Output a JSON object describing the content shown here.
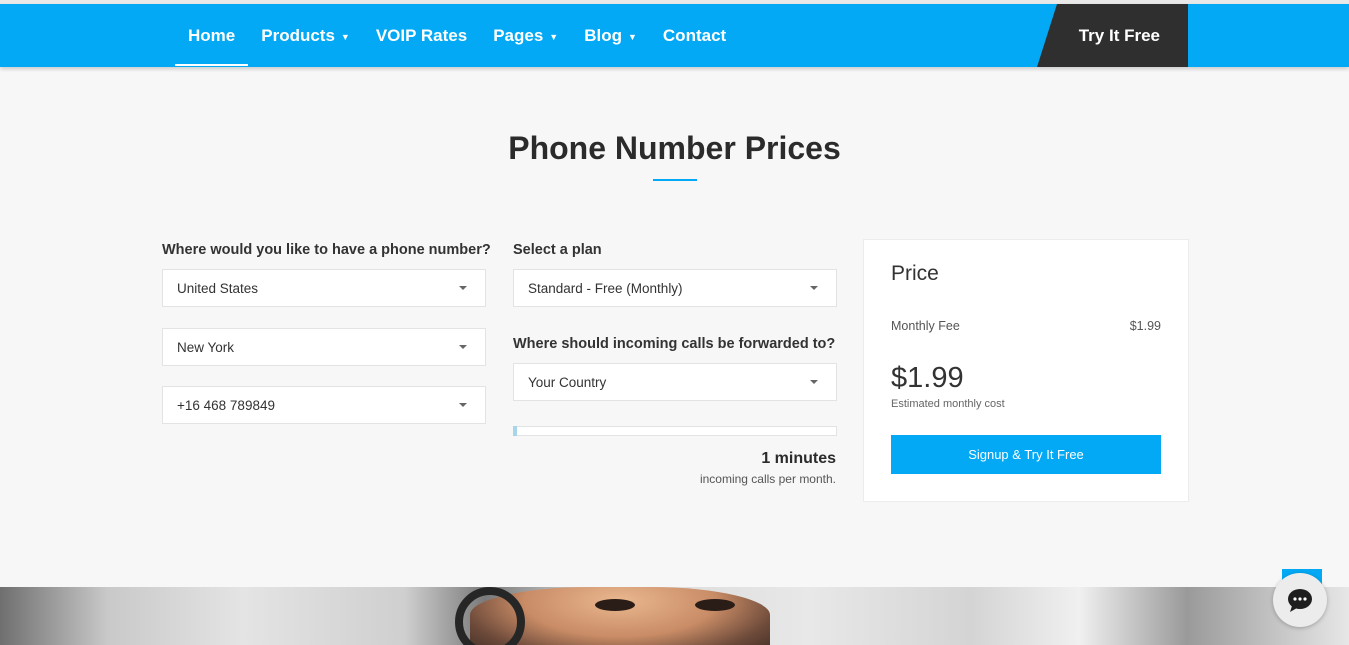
{
  "nav": {
    "items": [
      {
        "label": "Home",
        "dropdown": false,
        "active": true
      },
      {
        "label": "Products",
        "dropdown": true,
        "active": false
      },
      {
        "label": "VOIP Rates",
        "dropdown": false,
        "active": false
      },
      {
        "label": "Pages",
        "dropdown": true,
        "active": false
      },
      {
        "label": "Blog",
        "dropdown": true,
        "active": false
      },
      {
        "label": "Contact",
        "dropdown": false,
        "active": false
      }
    ],
    "cta": "Try It Free",
    "color": "#03a9f4"
  },
  "page": {
    "title": "Phone Number Prices"
  },
  "left_form": {
    "question": "Where would you like to have a phone number?",
    "country": "United States",
    "city": "New York",
    "number": "+16 468 789849"
  },
  "middle_form": {
    "plan_label": "Select a plan",
    "plan": "Standard - Free (Monthly)",
    "forward_label": "Where should incoming calls be forwarded to?",
    "forward_country": "Your Country",
    "slider_fraction": 0,
    "minutes": "1 minutes",
    "minutes_caption": "incoming calls per month."
  },
  "price_card": {
    "heading": "Price",
    "fee_label": "Monthly Fee",
    "fee_value": "$1.99",
    "total": "$1.99",
    "total_caption": "Estimated monthly cost",
    "signup": "Signup & Try It Free"
  },
  "chat": {
    "icon": "chat-bubble-icon"
  }
}
